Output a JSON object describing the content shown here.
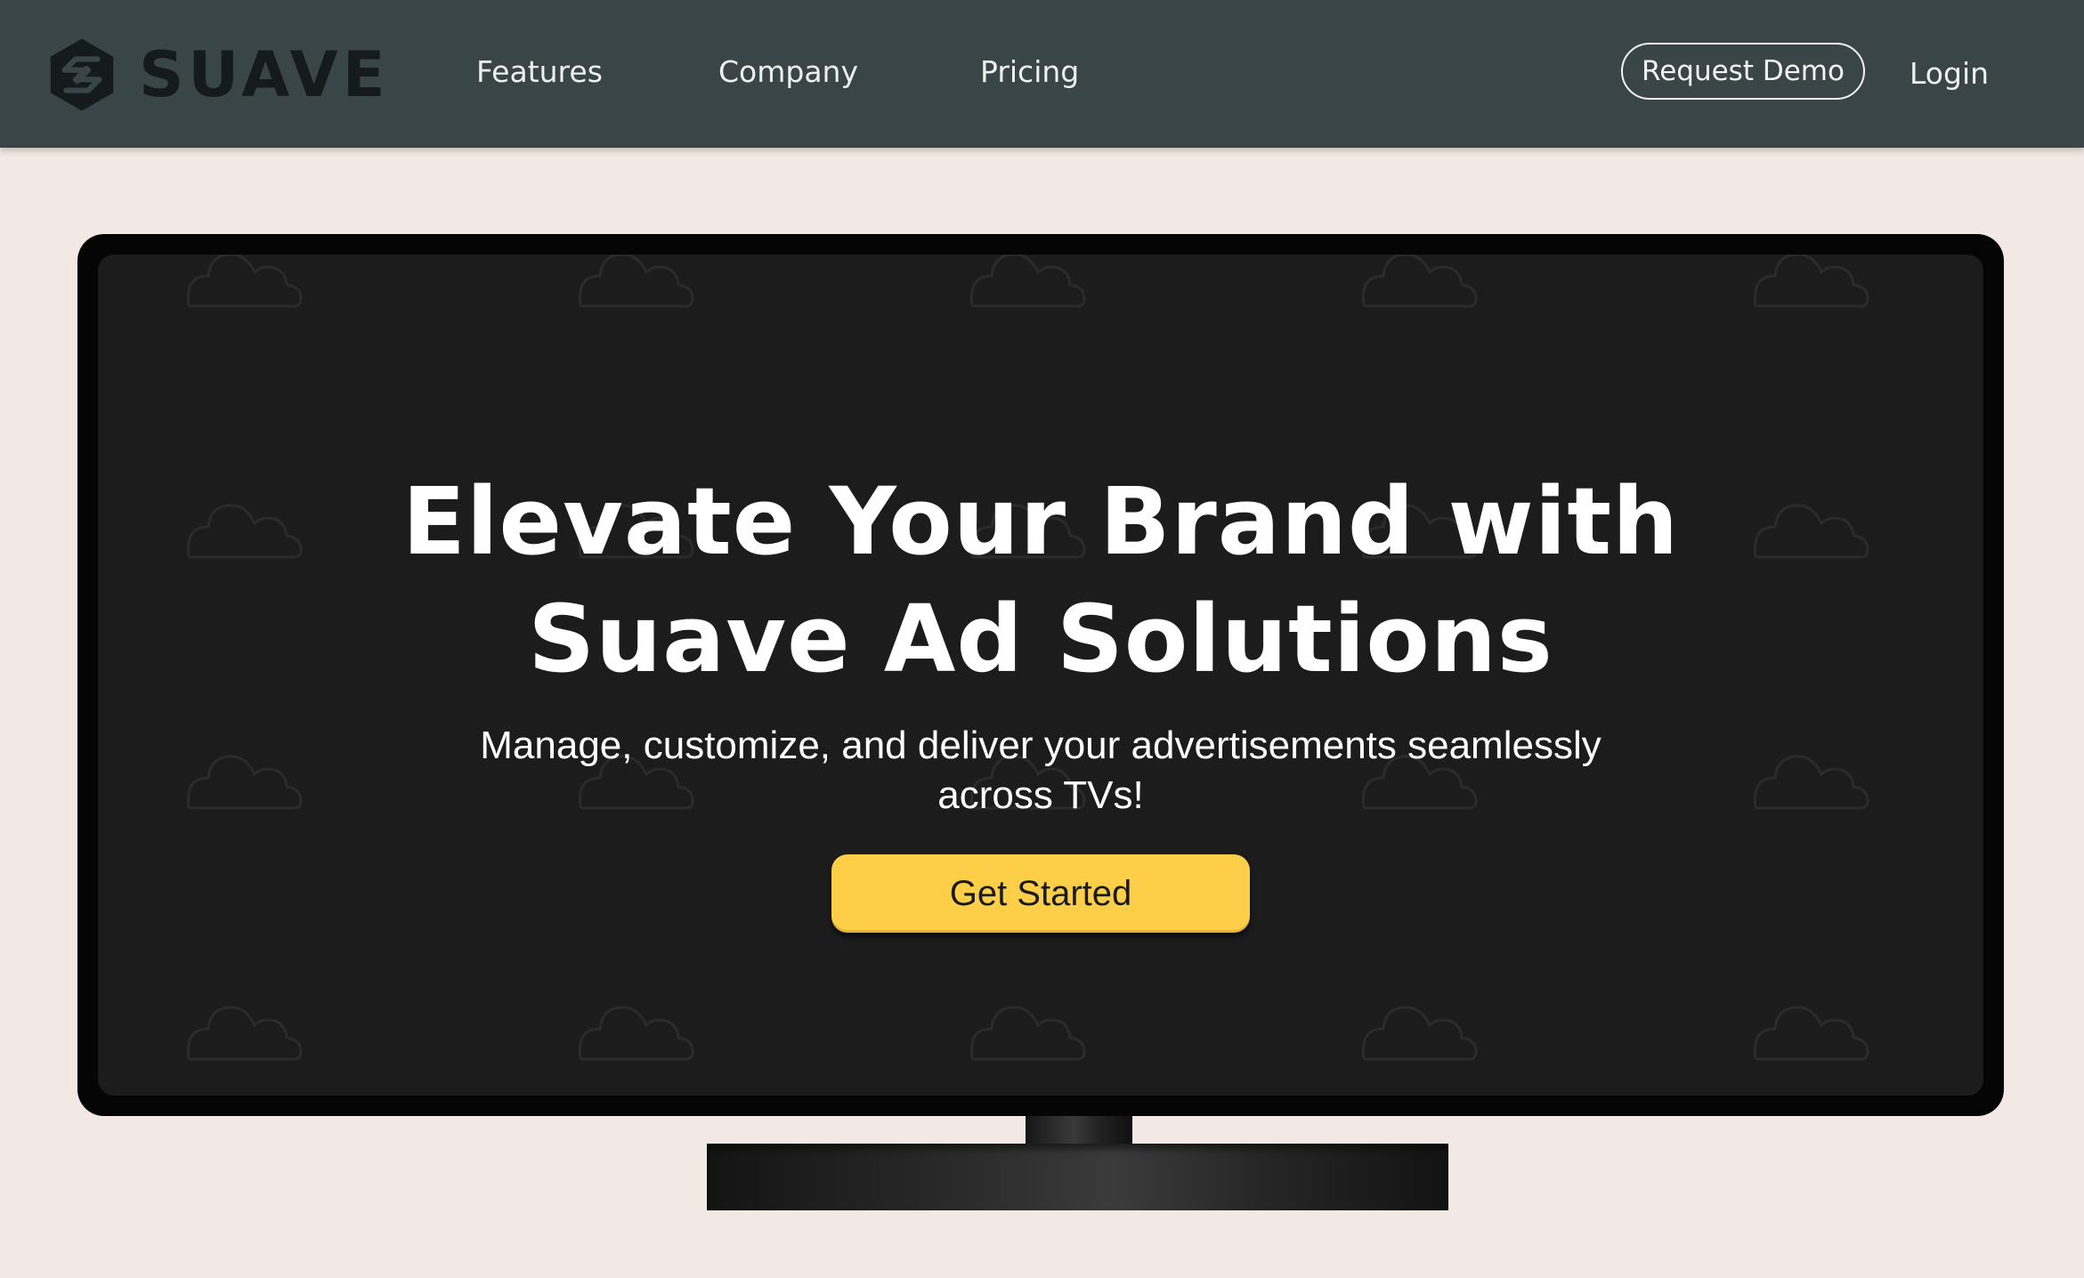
{
  "brand": {
    "name": "SUAVE",
    "logo_icon": "hexagon-s-logo-icon"
  },
  "nav": {
    "links": [
      "Features",
      "Company",
      "Pricing"
    ],
    "request_demo": "Request Demo",
    "login": "Login"
  },
  "hero": {
    "title_line1": "Elevate Your Brand with",
    "title_line2": "Suave Ad Solutions",
    "subtitle_line1": "Manage, customize, and deliver your advertisements seamlessly",
    "subtitle_line2": "across TVs!",
    "cta_label": "Get Started",
    "background_icon": "cloud-icon"
  },
  "colors": {
    "navbar": "#394547",
    "page_background": "#f3e9e4",
    "screen": "#1c1c1c",
    "cta": "#fdcf48"
  }
}
